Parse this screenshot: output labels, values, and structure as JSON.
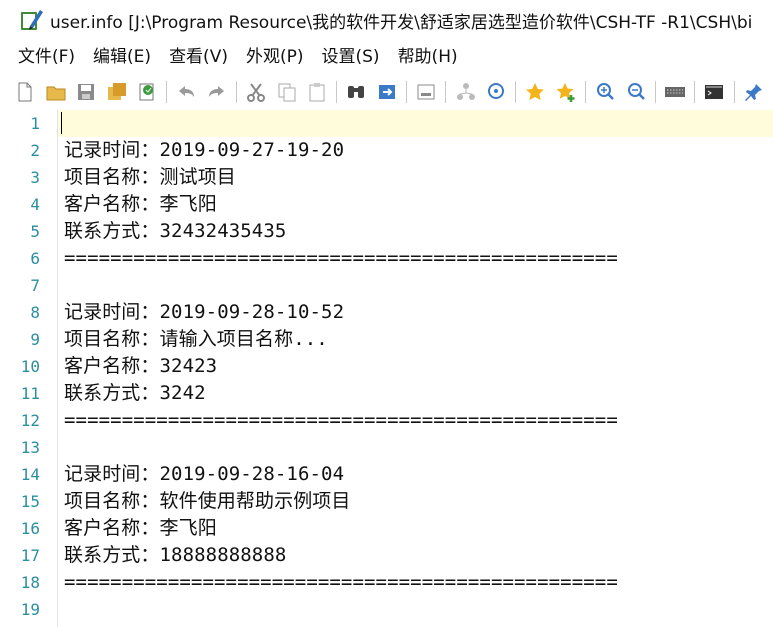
{
  "window": {
    "title": "user.info [J:\\Program Resource\\我的软件开发\\舒适家居选型造价软件\\CSH-TF -R1\\CSH\\bi"
  },
  "menu": {
    "items": [
      "文件(F)",
      "编辑(E)",
      "查看(V)",
      "外观(P)",
      "设置(S)",
      "帮助(H)"
    ]
  },
  "toolbar": {
    "icons": [
      "new-file-icon",
      "open-folder-icon",
      "save-icon",
      "save-all-icon",
      "reload-icon",
      "undo-icon",
      "redo-icon",
      "cut-icon",
      "copy-icon",
      "paste-icon",
      "find-icon",
      "replace-icon",
      "goto-icon",
      "filter-icon",
      "find-in-files-icon",
      "bookmark-icon",
      "bookmark-add-icon",
      "zoom-in-icon",
      "zoom-out-icon",
      "keyboard-icon",
      "terminal-icon",
      "pin-icon"
    ]
  },
  "editor": {
    "lines": [
      {
        "n": "1",
        "text": ""
      },
      {
        "n": "2",
        "text": "记录时间：2019-09-27-19-20"
      },
      {
        "n": "3",
        "text": "项目名称：测试项目"
      },
      {
        "n": "4",
        "text": "客户名称：李飞阳"
      },
      {
        "n": "5",
        "text": "联系方式：32432435435"
      },
      {
        "n": "6",
        "text": "================================================"
      },
      {
        "n": "7",
        "text": ""
      },
      {
        "n": "8",
        "text": "记录时间：2019-09-28-10-52"
      },
      {
        "n": "9",
        "text": "项目名称：请输入项目名称..."
      },
      {
        "n": "10",
        "text": "客户名称：32423"
      },
      {
        "n": "11",
        "text": "联系方式：3242"
      },
      {
        "n": "12",
        "text": "================================================"
      },
      {
        "n": "13",
        "text": ""
      },
      {
        "n": "14",
        "text": "记录时间：2019-09-28-16-04"
      },
      {
        "n": "15",
        "text": "项目名称：软件使用帮助示例项目"
      },
      {
        "n": "16",
        "text": "客户名称：李飞阳"
      },
      {
        "n": "17",
        "text": "联系方式：18888888888"
      },
      {
        "n": "18",
        "text": "================================================"
      },
      {
        "n": "19",
        "text": ""
      }
    ]
  }
}
